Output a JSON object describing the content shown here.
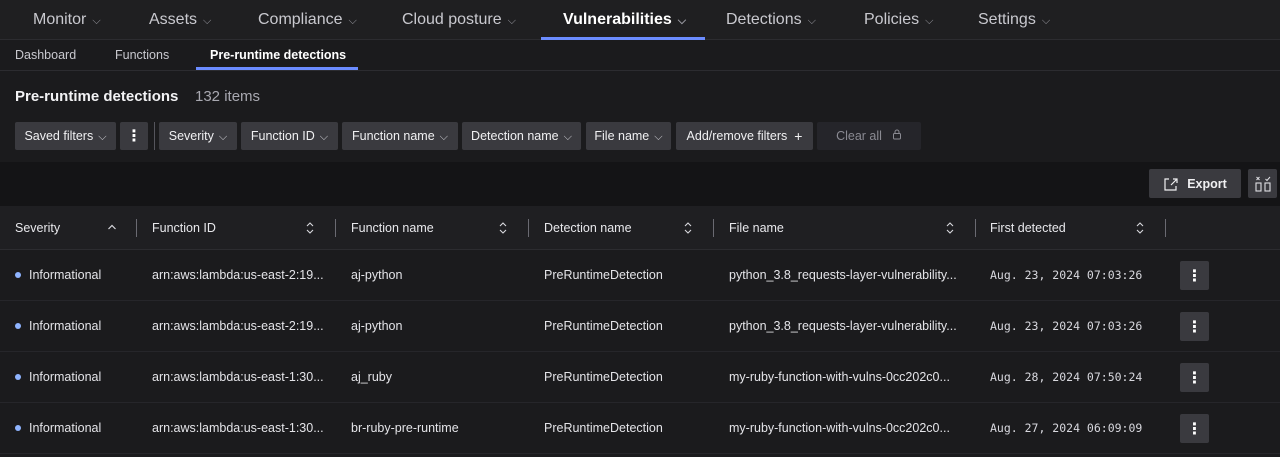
{
  "topnav": {
    "items": [
      {
        "label": "Monitor"
      },
      {
        "label": "Assets"
      },
      {
        "label": "Compliance"
      },
      {
        "label": "Cloud posture"
      },
      {
        "label": "Vulnerabilities"
      },
      {
        "label": "Detections"
      },
      {
        "label": "Policies"
      },
      {
        "label": "Settings"
      }
    ],
    "active": "Vulnerabilities"
  },
  "subnav": {
    "items": [
      {
        "label": "Dashboard"
      },
      {
        "label": "Functions"
      },
      {
        "label": "Pre-runtime detections"
      }
    ],
    "active": "Pre-runtime detections"
  },
  "page": {
    "title": "Pre-runtime detections",
    "count": "132 items"
  },
  "filters": {
    "saved_filters": "Saved filters",
    "severity": "Severity",
    "function_id": "Function ID",
    "function_name": "Function name",
    "detection_name": "Detection name",
    "file_name": "File name",
    "add_remove": "Add/remove filters",
    "clear_all": "Clear all"
  },
  "toolbar": {
    "export_label": "Export"
  },
  "table": {
    "columns": [
      "Severity",
      "Function ID",
      "Function name",
      "Detection name",
      "File name",
      "First detected"
    ],
    "rows": [
      {
        "severity": "Informational",
        "function_id": "arn:aws:lambda:us-east-2:19...",
        "function_name": "aj-python",
        "detection_name": "PreRuntimeDetection",
        "file_name": "python_3.8_requests-layer-vulnerability...",
        "first_detected": "Aug. 23, 2024 07:03:26"
      },
      {
        "severity": "Informational",
        "function_id": "arn:aws:lambda:us-east-2:19...",
        "function_name": "aj-python",
        "detection_name": "PreRuntimeDetection",
        "file_name": "python_3.8_requests-layer-vulnerability...",
        "first_detected": "Aug. 23, 2024 07:03:26"
      },
      {
        "severity": "Informational",
        "function_id": "arn:aws:lambda:us-east-1:30...",
        "function_name": "aj_ruby",
        "detection_name": "PreRuntimeDetection",
        "file_name": "my-ruby-function-with-vulns-0cc202c0...",
        "first_detected": "Aug. 28, 2024 07:50:24"
      },
      {
        "severity": "Informational",
        "function_id": "arn:aws:lambda:us-east-1:30...",
        "function_name": "br-ruby-pre-runtime",
        "detection_name": "PreRuntimeDetection",
        "file_name": "my-ruby-function-with-vulns-0cc202c0...",
        "first_detected": "Aug. 27, 2024 06:09:09"
      }
    ]
  },
  "colors": {
    "accent": "#6b8cff",
    "informational_dot": "#8fb4ff"
  }
}
